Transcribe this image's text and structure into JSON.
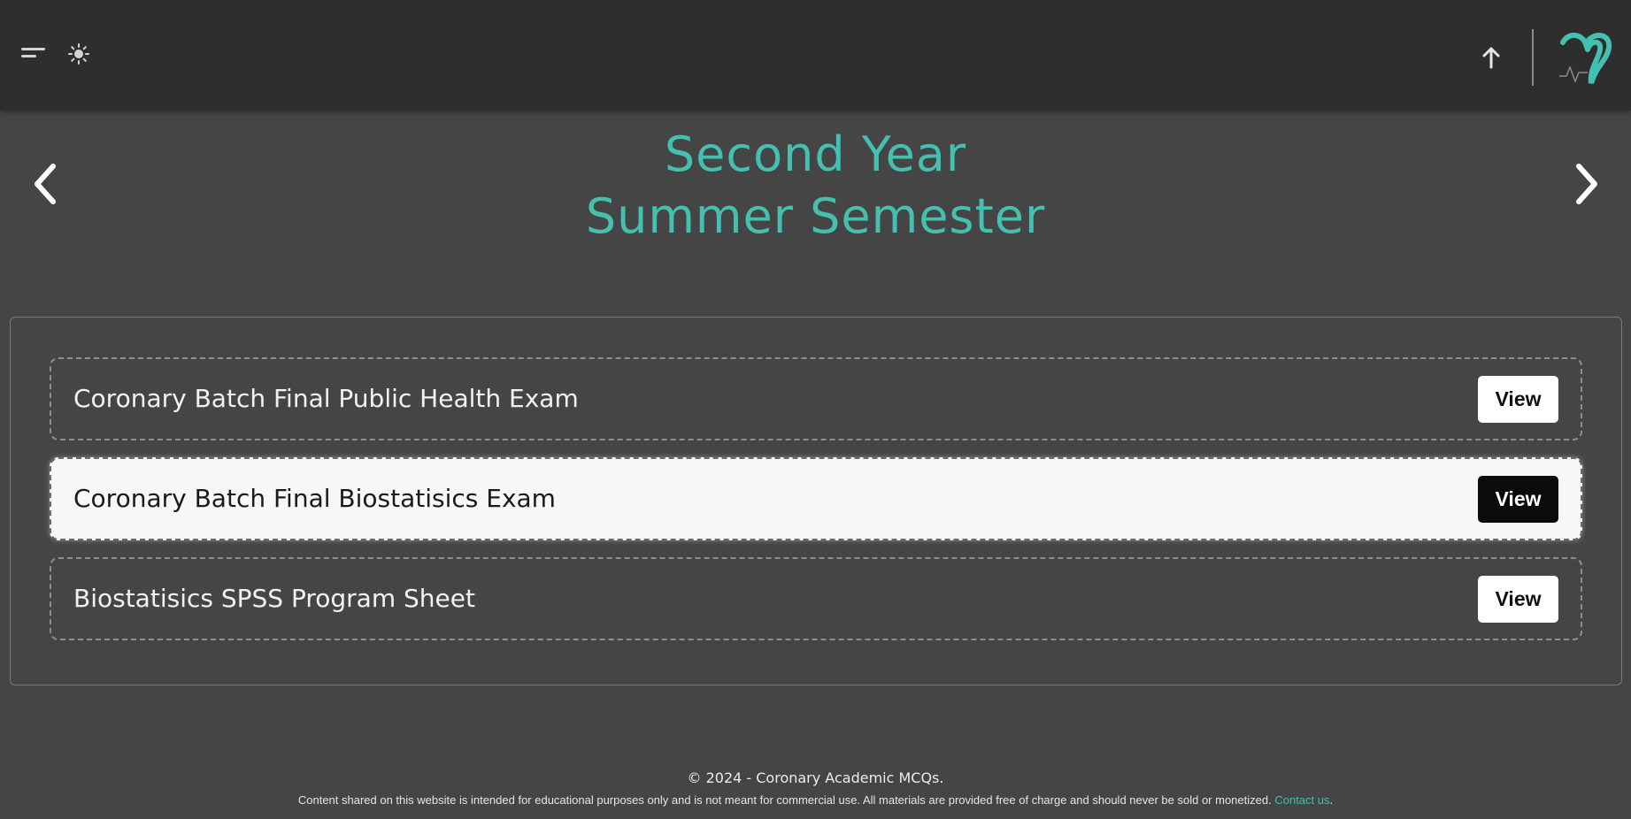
{
  "header": {
    "menu_icon": "menu-icon",
    "theme_icon": "sun-icon",
    "scroll_top_icon": "arrow-up-icon",
    "logo": "coronary-heart-logo"
  },
  "navigation": {
    "prev_icon": "chevron-left-icon",
    "next_icon": "chevron-right-icon"
  },
  "heading": {
    "line1": "Second Year",
    "line2": "Summer Semester"
  },
  "items": [
    {
      "title": "Coronary Batch Final Public Health Exam",
      "button": "View",
      "active": false
    },
    {
      "title": "Coronary Batch Final Biostatisics Exam",
      "button": "View",
      "active": true
    },
    {
      "title": "Biostatisics SPSS Program Sheet",
      "button": "View",
      "active": false
    }
  ],
  "footer": {
    "copyright": "© 2024 - Coronary Academic MCQs.",
    "note": "Content shared on this website is intended for educational purposes only and is not meant for commercial use. All materials are provided free of charge and should never be sold or monetized.",
    "contact_link": "Contact us",
    "note_end": "."
  },
  "colors": {
    "accent": "#45bfb0",
    "background": "#454545",
    "topbar": "#2e2e2e"
  }
}
